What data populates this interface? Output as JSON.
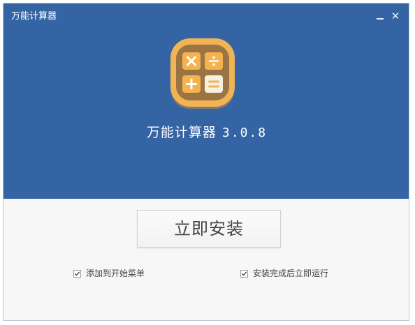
{
  "window": {
    "title": "万能计算器",
    "minimize_glyph": "—",
    "close_glyph": "✕"
  },
  "app": {
    "name": "万能计算器",
    "version": "3.0.8",
    "icon_name": "calculator-app-icon",
    "icon_keys": [
      "×",
      "÷",
      "+",
      "="
    ]
  },
  "install": {
    "button_label": "立即安装"
  },
  "options": [
    {
      "label": "添加到开始菜单",
      "checked": true
    },
    {
      "label": "安装完成后立即运行",
      "checked": true
    }
  ],
  "colors": {
    "banner": "#3564a5",
    "icon_outer": "#f0b455",
    "icon_inner": "#9a7444",
    "key_orange": "#f5b34f",
    "key_light": "#f8efdf"
  }
}
